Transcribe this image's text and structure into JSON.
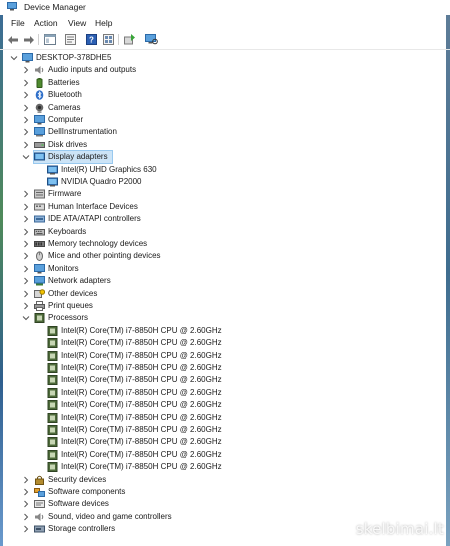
{
  "window": {
    "title": "Device Manager"
  },
  "menu": [
    "File",
    "Action",
    "View",
    "Help"
  ],
  "toolbar": [
    "back-icon",
    "forward-icon",
    "show-hide-tree-icon",
    "properties-icon",
    "help-icon",
    "view-icon",
    "update-driver-icon",
    "scan-hardware-icon"
  ],
  "root": {
    "label": "DESKTOP-378DHE5"
  },
  "categories_before": [
    {
      "label": "Audio inputs and outputs",
      "icon": "speaker-icon"
    },
    {
      "label": "Batteries",
      "icon": "battery-icon"
    },
    {
      "label": "Bluetooth",
      "icon": "bluetooth-icon"
    },
    {
      "label": "Cameras",
      "icon": "camera-icon"
    },
    {
      "label": "Computer",
      "icon": "computer-icon"
    },
    {
      "label": "DellInstrumentation",
      "icon": "instrumentation-icon"
    },
    {
      "label": "Disk drives",
      "icon": "disk-drive-icon"
    }
  ],
  "display_adapters": {
    "label": "Display adapters",
    "children": [
      "Intel(R) UHD Graphics 630",
      "NVIDIA Quadro P2000"
    ]
  },
  "categories_mid": [
    {
      "label": "Firmware",
      "icon": "firmware-icon"
    },
    {
      "label": "Human Interface Devices",
      "icon": "hid-icon"
    },
    {
      "label": "IDE ATA/ATAPI controllers",
      "icon": "ide-controller-icon"
    },
    {
      "label": "Keyboards",
      "icon": "keyboard-icon"
    },
    {
      "label": "Memory technology devices",
      "icon": "memory-icon"
    },
    {
      "label": "Mice and other pointing devices",
      "icon": "mouse-icon"
    },
    {
      "label": "Monitors",
      "icon": "monitor-icon"
    },
    {
      "label": "Network adapters",
      "icon": "network-adapter-icon"
    },
    {
      "label": "Other devices",
      "icon": "other-devices-icon"
    },
    {
      "label": "Print queues",
      "icon": "printer-icon"
    }
  ],
  "processors": {
    "label": "Processors",
    "children": [
      "Intel(R) Core(TM) i7-8850H CPU @ 2.60GHz",
      "Intel(R) Core(TM) i7-8850H CPU @ 2.60GHz",
      "Intel(R) Core(TM) i7-8850H CPU @ 2.60GHz",
      "Intel(R) Core(TM) i7-8850H CPU @ 2.60GHz",
      "Intel(R) Core(TM) i7-8850H CPU @ 2.60GHz",
      "Intel(R) Core(TM) i7-8850H CPU @ 2.60GHz",
      "Intel(R) Core(TM) i7-8850H CPU @ 2.60GHz",
      "Intel(R) Core(TM) i7-8850H CPU @ 2.60GHz",
      "Intel(R) Core(TM) i7-8850H CPU @ 2.60GHz",
      "Intel(R) Core(TM) i7-8850H CPU @ 2.60GHz",
      "Intel(R) Core(TM) i7-8850H CPU @ 2.60GHz",
      "Intel(R) Core(TM) i7-8850H CPU @ 2.60GHz"
    ]
  },
  "categories_after": [
    {
      "label": "Security devices",
      "icon": "security-device-icon"
    },
    {
      "label": "Software components",
      "icon": "software-component-icon"
    },
    {
      "label": "Software devices",
      "icon": "software-device-icon"
    },
    {
      "label": "Sound, video and game controllers",
      "icon": "sound-controller-icon"
    },
    {
      "label": "Storage controllers",
      "icon": "storage-controller-icon"
    }
  ],
  "watermark": "skelbimai.lt",
  "colors": {
    "selection": "#cce4f7",
    "selection_border": "#99c9ef",
    "accent": "#2b78c2"
  }
}
